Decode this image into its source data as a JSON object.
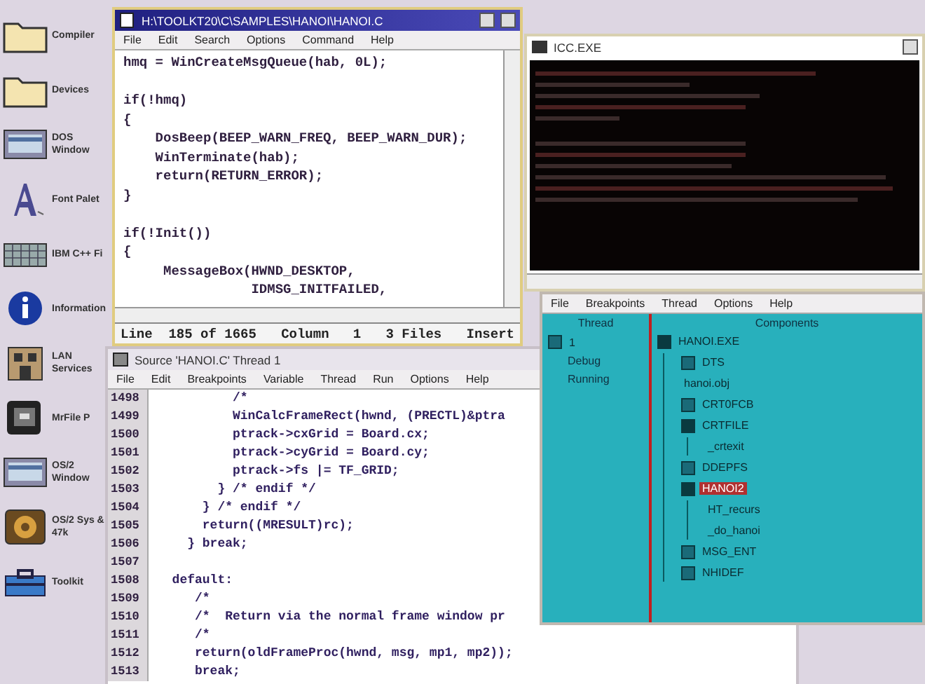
{
  "desktop_icons": [
    {
      "label": "Compiler",
      "kind": "folder"
    },
    {
      "label": "Devices",
      "kind": "folder"
    },
    {
      "label": "DOS Window",
      "kind": "monitor"
    },
    {
      "label": "Font Palet",
      "kind": "font"
    },
    {
      "label": "IBM C++ Fi",
      "kind": "grid"
    },
    {
      "label": "Information",
      "kind": "info"
    },
    {
      "label": "LAN Services",
      "kind": "building"
    },
    {
      "label": "MrFile P",
      "kind": "file"
    },
    {
      "label": "OS/2 Window",
      "kind": "monitor"
    },
    {
      "label": "OS/2 Sys & 47k",
      "kind": "system"
    },
    {
      "label": "Toolkit",
      "kind": "toolkit"
    }
  ],
  "editor_window": {
    "title": "H:\\TOOLKT20\\C\\SAMPLES\\HANOI\\HANOI.C",
    "menu": [
      "File",
      "Edit",
      "Search",
      "Options",
      "Command",
      "Help"
    ],
    "code_lines": [
      {
        "text": "hmq = WinCreateMsgQueue(hab, 0L);",
        "gap_before": false
      },
      {
        "text": "if(!hmq)",
        "gap_before": true
      },
      {
        "text": "{",
        "gap_before": false
      },
      {
        "text": "    DosBeep(BEEP_WARN_FREQ, BEEP_WARN_DUR);",
        "gap_before": false
      },
      {
        "text": "    WinTerminate(hab);",
        "gap_before": false
      },
      {
        "text": "    return(RETURN_ERROR);",
        "gap_before": false
      },
      {
        "text": "}",
        "gap_before": false
      },
      {
        "text": "if(!Init())",
        "gap_before": true
      },
      {
        "text": "{",
        "gap_before": false
      },
      {
        "text": "     MessageBox(HWND_DESKTOP,",
        "gap_before": false
      },
      {
        "text": "                IDMSG_INITFAILED,",
        "gap_before": false
      }
    ],
    "status": [
      "Line  185 of 1665",
      "Column   1",
      "3 Files",
      "Insert"
    ]
  },
  "console_window": {
    "title": "ICC.EXE"
  },
  "source_window": {
    "title": "Source 'HANOI.C' Thread 1",
    "menu": [
      "File",
      "Edit",
      "Breakpoints",
      "Variable",
      "Thread",
      "Run",
      "Options",
      "Help"
    ],
    "lines": [
      {
        "number": "1498",
        "code": "          /*"
      },
      {
        "number": "1499",
        "code": "          WinCalcFrameRect(hwnd, (PRECTL)&ptra"
      },
      {
        "number": "1500",
        "code": "          ptrack->cxGrid = Board.cx;"
      },
      {
        "number": "1501",
        "code": "          ptrack->cyGrid = Board.cy;"
      },
      {
        "number": "1502",
        "code": "          ptrack->fs |= TF_GRID;"
      },
      {
        "number": "1503",
        "code": "        } /* endif */"
      },
      {
        "number": "1504",
        "code": "      } /* endif */"
      },
      {
        "number": "1505",
        "code": "      return((MRESULT)rc);"
      },
      {
        "number": "1506",
        "code": "    } break;"
      },
      {
        "number": "1507"
      },
      {
        "number": "1508",
        "code": "  default:"
      },
      {
        "number": "1509",
        "code": "     /*"
      },
      {
        "number": "1510",
        "code": "     /*  Return via the normal frame window pr"
      },
      {
        "number": "1511",
        "code": "     /*"
      },
      {
        "number": "1512",
        "code": "     return(oldFrameProc(hwnd, msg, mp1, mp2));"
      },
      {
        "number": "1513",
        "code": "     break;"
      }
    ]
  },
  "debugger_window": {
    "menu": [
      "File",
      "Breakpoints",
      "Thread",
      "Options",
      "Help"
    ],
    "thread_pane": {
      "heading": "Thread",
      "thread": "1",
      "items": [
        "Debug",
        "Running"
      ]
    },
    "components_pane": {
      "heading": "Components",
      "tree": [
        {
          "label": "HANOI.EXE",
          "expanded": true,
          "selected": false,
          "children": [
            {
              "label": "DTS",
              "expanded": false,
              "selected": false
            },
            {
              "label": "hanoi.obj",
              "selected": false
            },
            {
              "label": "CRT0FCB",
              "expanded": false,
              "selected": false
            },
            {
              "label": "CRTFILE",
              "expanded": true,
              "selected": false,
              "children": [
                {
                  "label": "_crtexit",
                  "selected": false
                }
              ]
            },
            {
              "label": "DDEPFS",
              "expanded": false,
              "selected": false
            },
            {
              "label": "HANOI2",
              "expanded": true,
              "selected": true,
              "children": [
                {
                  "label": "HT_recurs",
                  "selected": false
                },
                {
                  "label": "_do_hanoi",
                  "selected": false
                }
              ]
            },
            {
              "label": "MSG_ENT",
              "expanded": false,
              "selected": false
            },
            {
              "label": "NHIDEF",
              "expanded": false,
              "selected": false
            }
          ]
        }
      ]
    }
  }
}
